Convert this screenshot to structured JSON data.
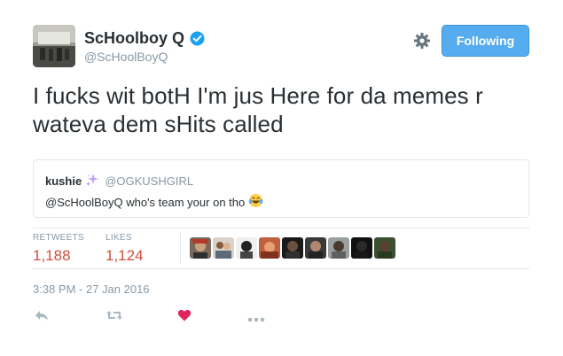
{
  "author": {
    "name": "ScHoolboy Q",
    "handle": "@ScHoolBoyQ"
  },
  "follow_button": {
    "label": "Following"
  },
  "tweet": {
    "text": "I fucks wit botH I'm jus Here for da memes r wateva dem sHits called"
  },
  "quoted_tweet": {
    "name": "kushie",
    "handle": "@OGKUSHGIRL",
    "text": "@ScHoolBoyQ who's team your on tho"
  },
  "stats": {
    "retweets_label": "RETWEETS",
    "retweets_value": "1,188",
    "likes_label": "LIKES",
    "likes_value": "1,124"
  },
  "timestamp": "3:38 PM - 27 Jan 2016",
  "colors": {
    "accent": "#55acee",
    "like": "#e0245e",
    "muted": "#8899a6"
  }
}
